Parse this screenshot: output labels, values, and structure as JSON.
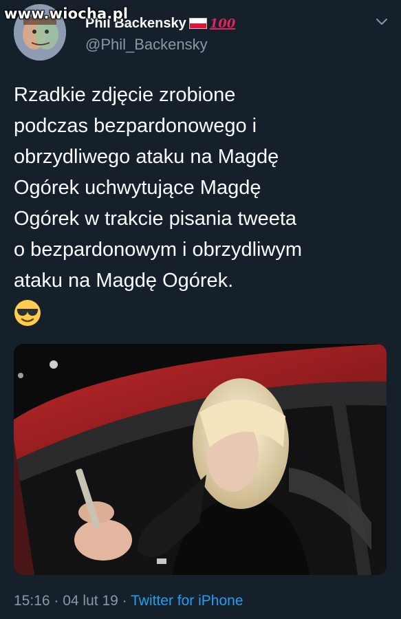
{
  "watermark": "www.wiocha.pl",
  "author": {
    "display_name": "Phil Backensky",
    "handle": "@Phil_Backensky",
    "badge_emoji": "100"
  },
  "tweet": {
    "text": "Rzadkie zdjęcie zrobione\npodczas bezpardonowego i\nobrzydliwego ataku na Magdę\nOgórek uchwytujące Magdę\nOgórek w trakcie pisania tweeta\no bezpardonowym i obrzydliwym\nataku na Magdę Ogórek.",
    "emoji": "smiling-face-with-sunglasses"
  },
  "meta": {
    "time": "15:16",
    "separator1": " · ",
    "date": "04 lut 19",
    "separator2": " · ",
    "source": "Twitter for iPhone"
  },
  "colors": {
    "background": "#15202b",
    "text": "#ffffff",
    "secondary": "#8899a6",
    "link": "#1da1f2"
  }
}
